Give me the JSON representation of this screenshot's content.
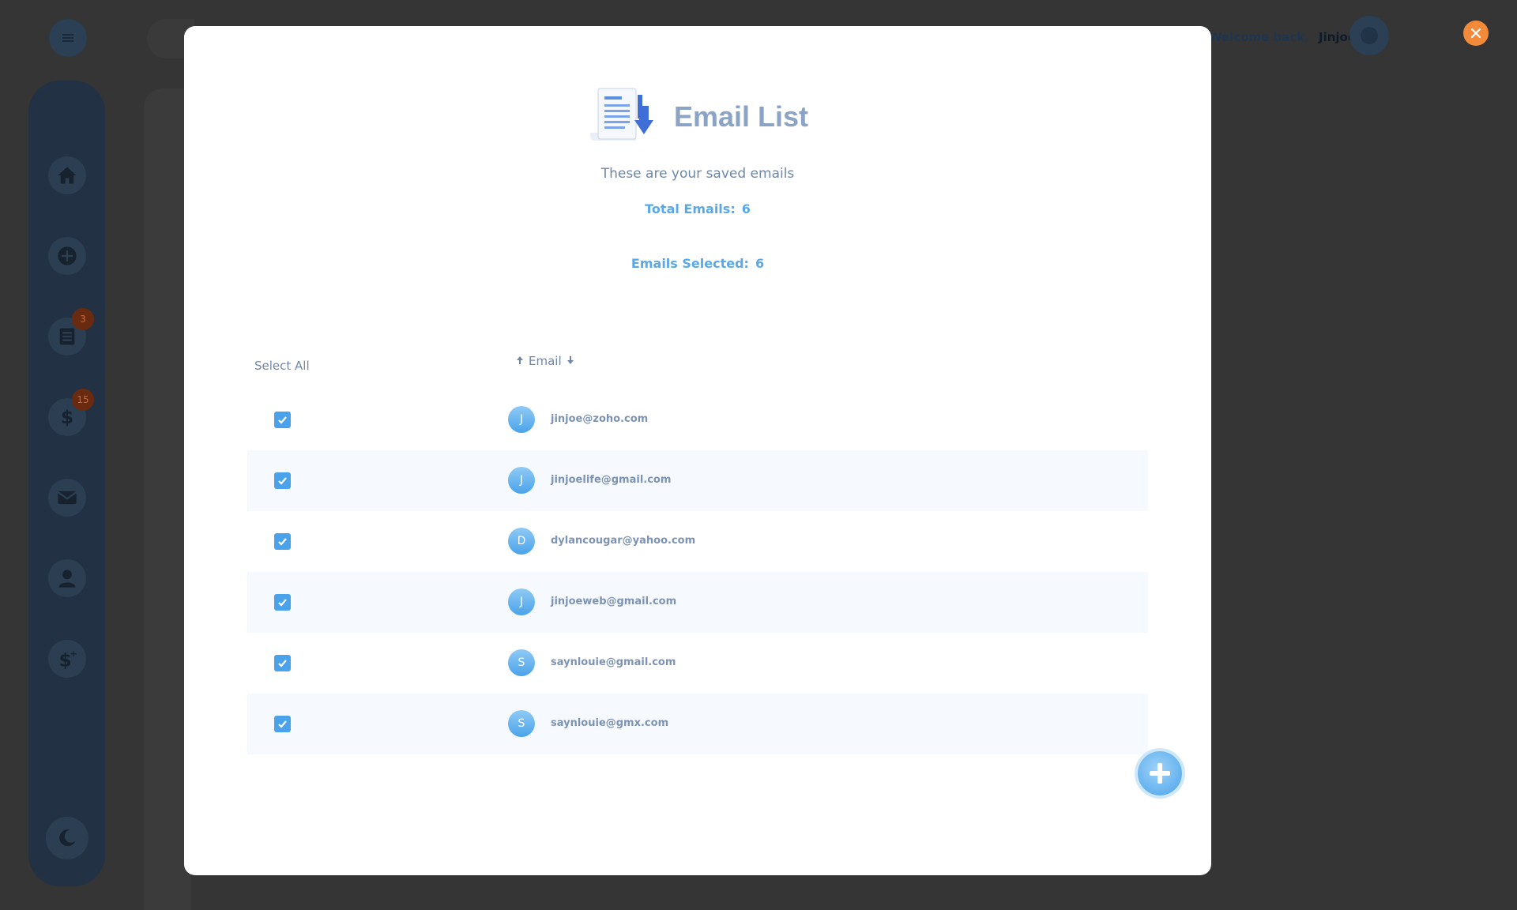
{
  "header": {
    "welcome_text": "Welcome back,",
    "username": "Jinjoe"
  },
  "sidebar": {
    "items": [
      {
        "name": "home",
        "badge": ""
      },
      {
        "name": "add",
        "badge": ""
      },
      {
        "name": "list",
        "badge": "3"
      },
      {
        "name": "dollar",
        "badge": "15"
      },
      {
        "name": "mail",
        "badge": ""
      },
      {
        "name": "user",
        "badge": ""
      },
      {
        "name": "dollar-plus",
        "badge": ""
      }
    ]
  },
  "modal": {
    "title": "Email List",
    "subtitle": "These are your saved emails",
    "total_label": "Total Emails:",
    "total_value": "6",
    "selected_label": "Emails Selected:",
    "selected_value": "6",
    "select_all_label": "Select All",
    "email_column_label": "Email",
    "rows": [
      {
        "initial": "J",
        "email": "jinjoe@zoho.com",
        "checked": true
      },
      {
        "initial": "J",
        "email": "jinjoelife@gmail.com",
        "checked": true
      },
      {
        "initial": "D",
        "email": "dylancougar@yahoo.com",
        "checked": true
      },
      {
        "initial": "J",
        "email": "jinjoeweb@gmail.com",
        "checked": true
      },
      {
        "initial": "S",
        "email": "saynlouie@gmail.com",
        "checked": true
      },
      {
        "initial": "S",
        "email": "saynlouie@gmx.com",
        "checked": true
      }
    ]
  },
  "colors": {
    "accent": "#4aa3ea",
    "close": "#f28a3a",
    "title": "#8ba3c4"
  }
}
